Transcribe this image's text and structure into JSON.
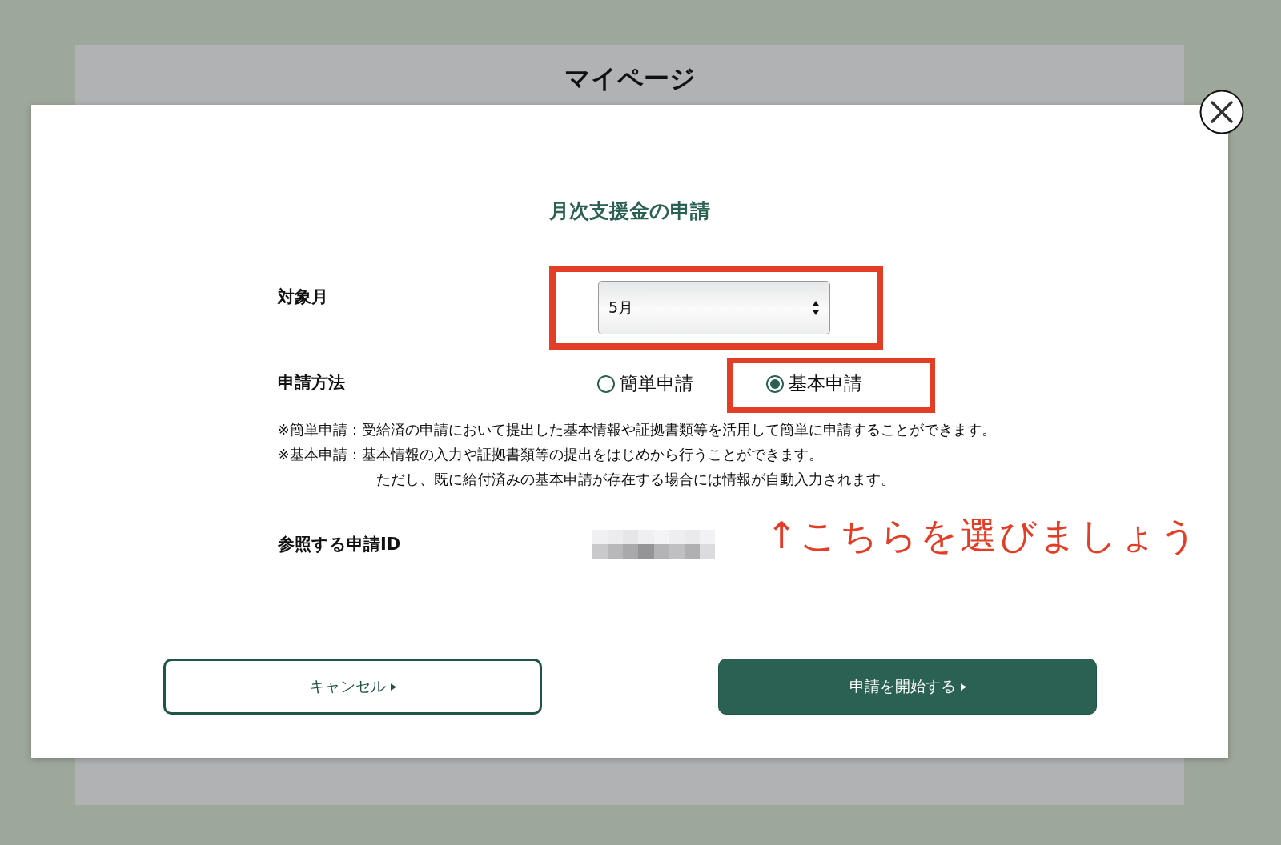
{
  "page": {
    "title": "マイページ"
  },
  "dialog": {
    "title": "月次支援金の申請",
    "month_field": {
      "label": "対象月",
      "value": "5月",
      "highlighted": true
    },
    "method_field": {
      "label": "申請方法",
      "options": [
        {
          "label": "簡単申請",
          "selected": false,
          "highlighted": false
        },
        {
          "label": "基本申請",
          "selected": true,
          "highlighted": true
        }
      ]
    },
    "notes": [
      {
        "kind": "note",
        "text": "※簡単申請：受給済の申請において提出した基本情報や証拠書類等を活用して簡単に申請することができます。"
      },
      {
        "kind": "note",
        "text": "※基本申請：基本情報の入力や証拠書類等の提出をはじめから行うことができます。"
      },
      {
        "kind": "continuation",
        "text": "ただし、既に給付済みの基本申請が存在する場合には情報が自動入力されます。"
      }
    ],
    "reference_id": {
      "label": "参照する申請ID",
      "annotation": "↑こちらを選びましょう"
    },
    "buttons": [
      {
        "kind": "secondary",
        "label": "キャンセル"
      },
      {
        "kind": "primary",
        "label": "申請を開始する"
      }
    ]
  }
}
